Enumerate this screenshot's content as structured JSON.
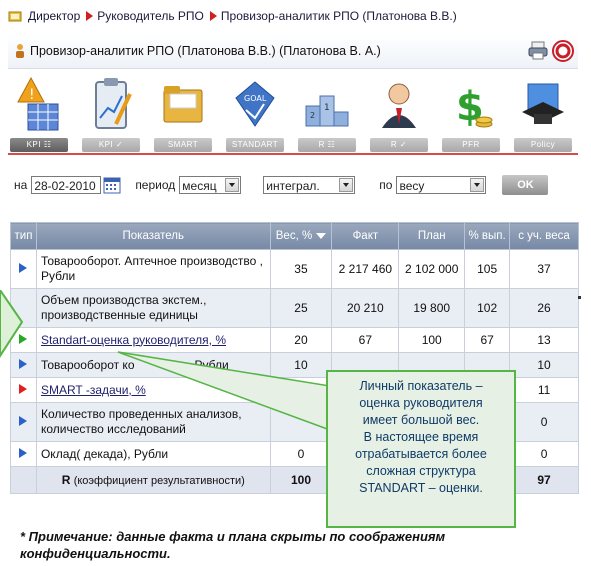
{
  "breadcrumb": [
    "Директор",
    "Руководитель РПО",
    "Провизор-аналитик РПО (Платонова В.В.)"
  ],
  "header": {
    "title": "Провизор-аналитик РПО (Платонова В.В.)  (Платонова В. А.)"
  },
  "toolbar": {
    "tabs": [
      {
        "label": "KPI",
        "icon": "kpi-warning-icon"
      },
      {
        "label": "KPI",
        "icon": "clipboard-chart-icon"
      },
      {
        "label": "SMART",
        "icon": "folder-icon"
      },
      {
        "label": "STANDART",
        "icon": "goal-badge-icon"
      },
      {
        "label": "R",
        "icon": "podium-icon"
      },
      {
        "label": "R",
        "icon": "manager-icon"
      },
      {
        "label": "PFR",
        "icon": "dollar-coins-icon"
      },
      {
        "label": "Policy",
        "icon": "graduation-cap-icon"
      }
    ]
  },
  "filters": {
    "date_label": "на",
    "date_value": "28-02-2010",
    "period_label": "период",
    "period_value": "месяц",
    "mode_value": "интеграл.",
    "by_label": "по",
    "by_value": "весу",
    "ok_label": "OK"
  },
  "table": {
    "headers": [
      "тип",
      "Показатель",
      "Вес, %",
      "Факт",
      "План",
      "% вып.",
      "с уч. веса"
    ],
    "rows": [
      {
        "name": "Товарооборот. Аптечное производство , Рубли",
        "weight": "35",
        "fact": "2 217 460",
        "plan": "2 102 000",
        "pct": "105",
        "weighted": "37",
        "marker": "blue"
      },
      {
        "name": "Объем производства экстем., производственные единицы",
        "weight": "25",
        "fact": "20 210",
        "plan": "19 800",
        "pct": "102",
        "weighted": "26",
        "marker": "none"
      },
      {
        "name": "Standart-оценка руководителя, %",
        "weight": "20",
        "fact": "67",
        "plan": "100",
        "pct": "67",
        "weighted": "13",
        "marker": "green",
        "link": true
      },
      {
        "name": "Товарооборот ко",
        "name_tail": "Рубли",
        "weight": "10",
        "fact": "",
        "plan": "",
        "pct": "",
        "weighted": "10",
        "marker": "blue"
      },
      {
        "name": "SMART -задачи, %",
        "weight": "",
        "fact": "",
        "plan": "",
        "pct": "",
        "weighted": "11",
        "marker": "red",
        "link": true
      },
      {
        "name": "Количество проведенных анализов, количество исследований",
        "weight": "",
        "fact": "",
        "plan": "",
        "pct": "",
        "weighted": "0",
        "marker": "blue"
      },
      {
        "name": "Оклад( декада), Рубли",
        "weight": "0",
        "fact": "",
        "plan": "",
        "pct": "",
        "weighted": "0",
        "marker": "blue"
      }
    ],
    "total": {
      "label": "R",
      "label_tail": "(коэффициент результативности)",
      "weight": "100",
      "weighted": "97"
    }
  },
  "callout": {
    "lines": [
      "Личный показатель –",
      "оценка руководителя",
      "имеет большой вес.",
      "В настоящее время",
      "отрабатывается более",
      "сложная структура",
      "STANDART – оценки."
    ]
  },
  "note": "* Примечание: данные факта и плана скрыты по соображениям конфиденциальности.",
  "colors": {
    "accent_red": "#d21e1e",
    "callout_border": "#55b545",
    "header_blue": "#7688a4"
  }
}
